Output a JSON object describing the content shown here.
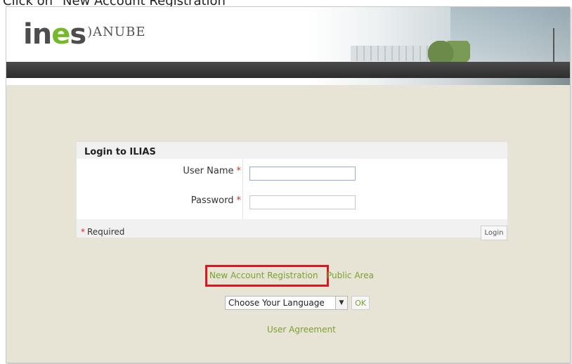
{
  "instruction": "Click on \"New Account Registration\"",
  "header": {
    "logo_ines": [
      "in",
      "e",
      "s"
    ],
    "logo_danube": "ANUBE"
  },
  "login": {
    "title": "Login to ILIAS",
    "username_label": "User Name",
    "password_label": "Password",
    "required_marker": "*",
    "required_note": "Required",
    "login_button": "Login",
    "username_value": "",
    "password_value": ""
  },
  "links": {
    "new_account": "New Account Registration",
    "public_area": "Public Area",
    "user_agreement": "User Agreement"
  },
  "language": {
    "selected": "Choose Your Language",
    "ok_button": "OK"
  },
  "colors": {
    "accent_green": "#7aa12f",
    "highlight_red": "#e0151c",
    "background": "#e7e4d6"
  }
}
